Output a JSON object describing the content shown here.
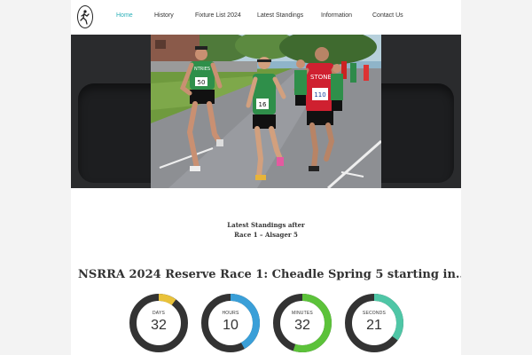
{
  "nav": {
    "logo": "club-logo",
    "links": [
      {
        "label": "Home",
        "active": true
      },
      {
        "label": "History",
        "active": false
      },
      {
        "label": "Fixture List 2024",
        "active": false
      },
      {
        "label": "Latest Standings",
        "active": false
      },
      {
        "label": "Information",
        "active": false
      },
      {
        "label": "Contact Us",
        "active": false
      }
    ]
  },
  "hero": {
    "bibs": [
      "50",
      "16",
      "110"
    ],
    "vest_texts": [
      "NTRIES",
      "STONE"
    ]
  },
  "standings": {
    "title": "Latest Standings after",
    "subtitle": "Race 1 – Alsager 5"
  },
  "race": {
    "heading": "NSRRA 2024 Reserve Race 1: Cheadle Spring 5 starting in..."
  },
  "countdown": [
    {
      "label": "DAYS",
      "value": "32",
      "progress": 0.1,
      "color": "#e9c23a"
    },
    {
      "label": "HOURS",
      "value": "10",
      "progress": 0.42,
      "color": "#3a9fd8"
    },
    {
      "label": "MINUTES",
      "value": "32",
      "progress": 0.55,
      "color": "#5cc23a"
    },
    {
      "label": "SECONDS",
      "value": "21",
      "progress": 0.35,
      "color": "#4fc6a6"
    }
  ]
}
